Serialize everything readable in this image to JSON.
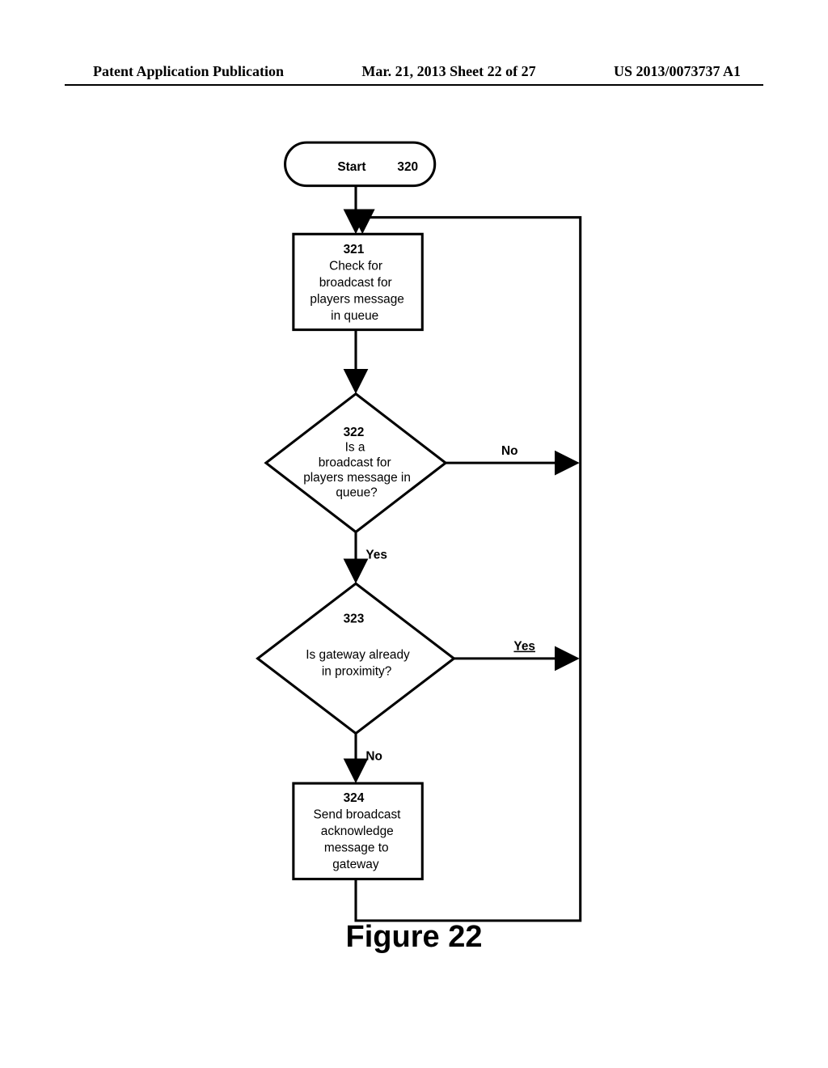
{
  "header": {
    "left": "Patent Application Publication",
    "mid": "Mar. 21, 2013  Sheet 22 of 27",
    "right": "US 2013/0073737 A1"
  },
  "figure_caption": "Figure 22",
  "flow": {
    "start": {
      "label": "Start",
      "ref": "320"
    },
    "step321": {
      "ref": "321",
      "l1": "Check for",
      "l2": "broadcast for",
      "l3": "players message",
      "l4": "in queue"
    },
    "decision322": {
      "ref": "322",
      "l1": "Is a",
      "l2": "broadcast for",
      "l3": "players message in",
      "l4": "queue?",
      "no": "No",
      "yes": "Yes"
    },
    "decision323": {
      "ref": "323",
      "l1": "Is gateway already",
      "l2": "in proximity?",
      "no": "No",
      "yes": "Yes"
    },
    "step324": {
      "ref": "324",
      "l1": "Send broadcast",
      "l2": "acknowledge",
      "l3": "message to",
      "l4": "gateway"
    }
  },
  "chart_data": {
    "type": "flowchart",
    "title": "Figure 22",
    "nodes": [
      {
        "id": "320",
        "shape": "terminator",
        "label": "Start"
      },
      {
        "id": "321",
        "shape": "process",
        "label": "Check for broadcast for players message in queue"
      },
      {
        "id": "322",
        "shape": "decision",
        "label": "Is a broadcast for players message in queue?"
      },
      {
        "id": "323",
        "shape": "decision",
        "label": "Is gateway already in proximity?"
      },
      {
        "id": "324",
        "shape": "process",
        "label": "Send broadcast acknowledge message to gateway"
      }
    ],
    "edges": [
      {
        "from": "320",
        "to": "321"
      },
      {
        "from": "321",
        "to": "322"
      },
      {
        "from": "322",
        "to": "321",
        "label": "No"
      },
      {
        "from": "322",
        "to": "323",
        "label": "Yes"
      },
      {
        "from": "323",
        "to": "321",
        "label": "Yes"
      },
      {
        "from": "323",
        "to": "324",
        "label": "No"
      },
      {
        "from": "324",
        "to": "321"
      }
    ]
  }
}
